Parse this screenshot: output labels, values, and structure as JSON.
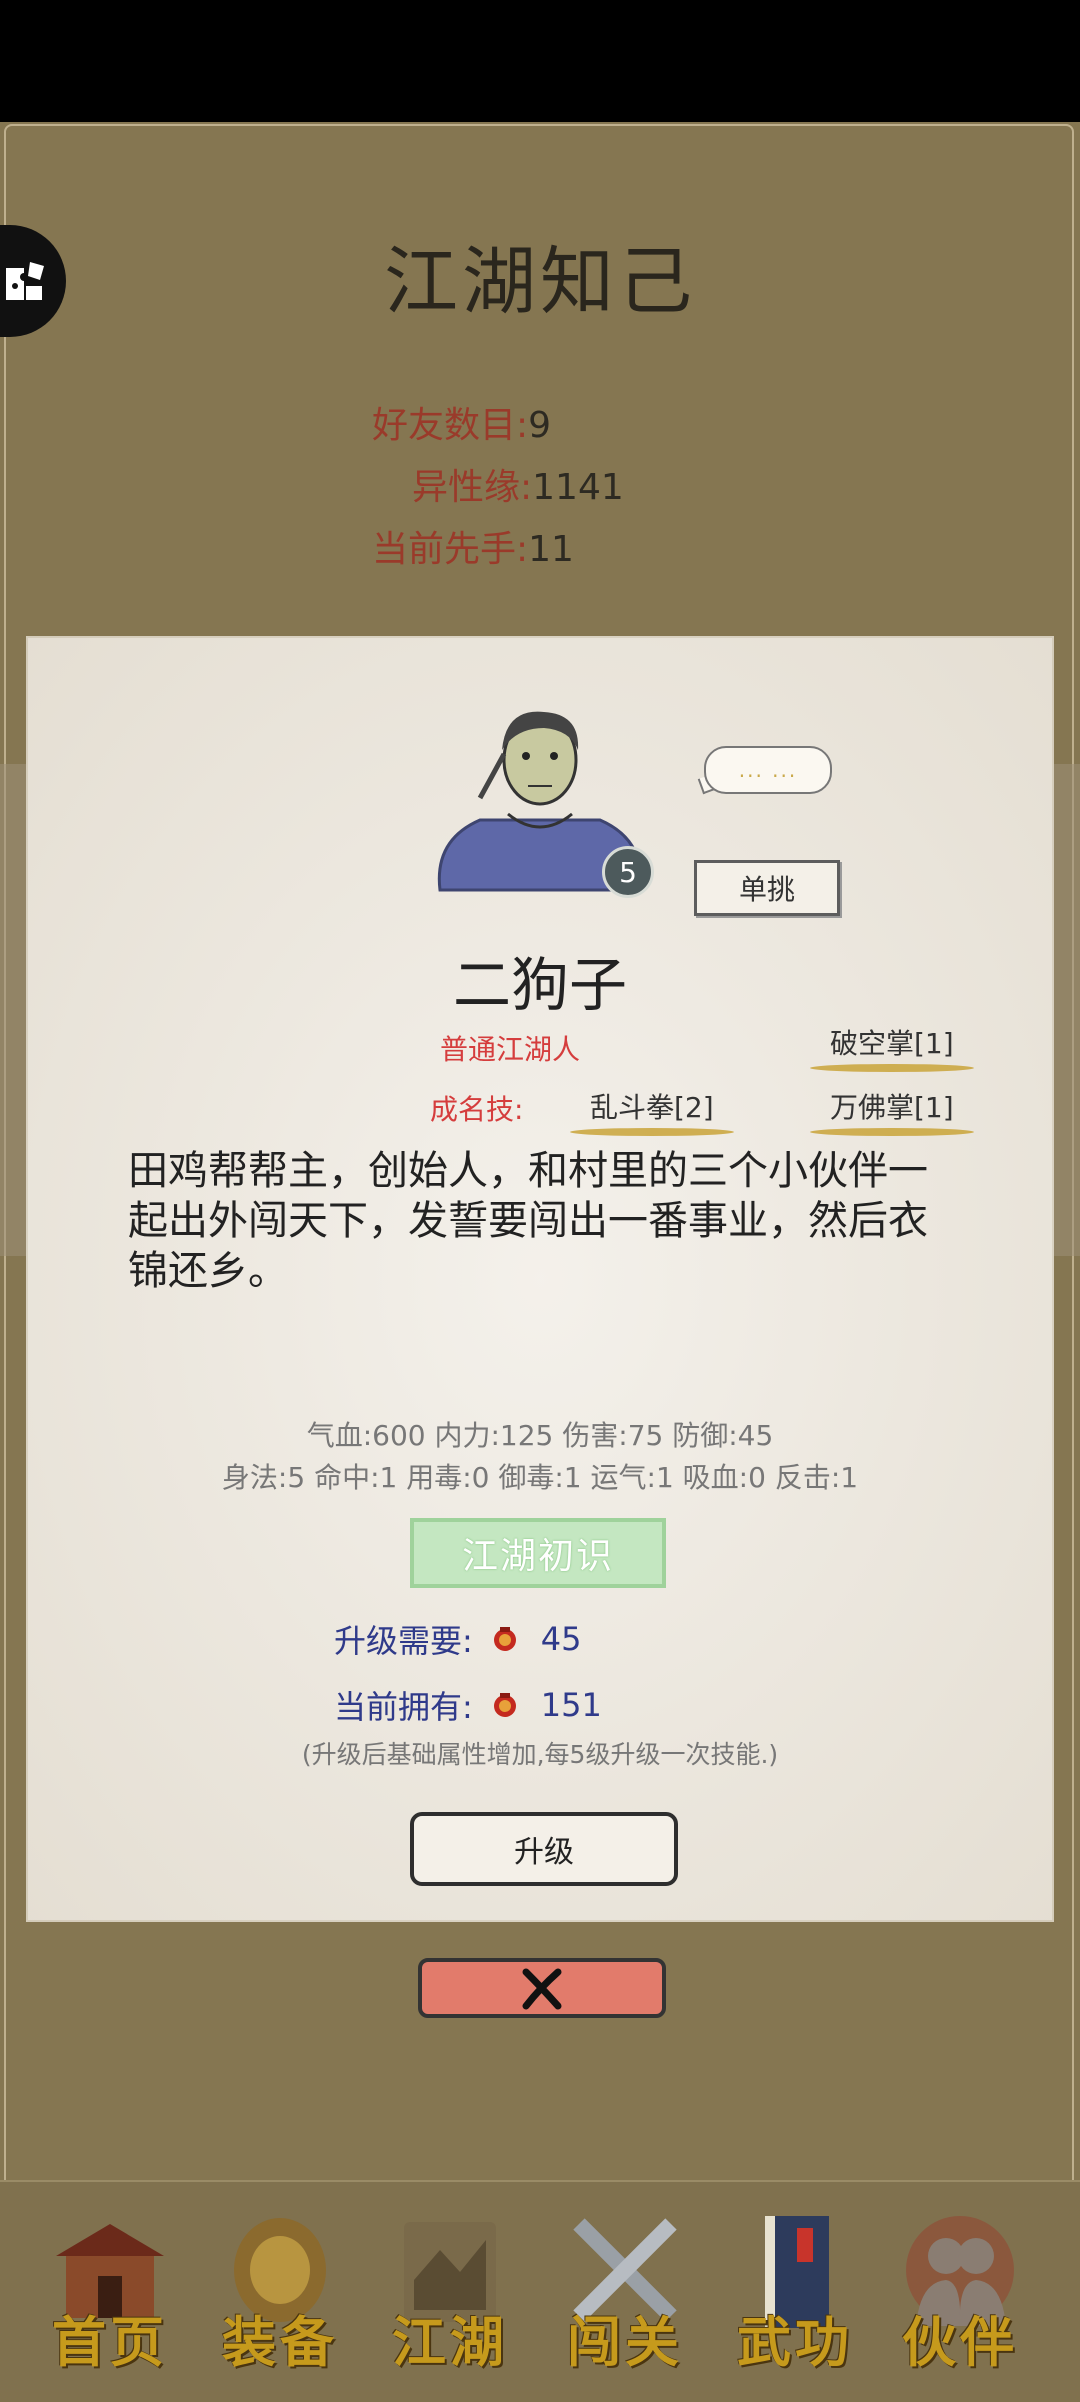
{
  "header": {
    "title": "江湖知己"
  },
  "summary": [
    {
      "label": "好友数目:",
      "value": "9"
    },
    {
      "label": "异性缘:",
      "value": "1141"
    },
    {
      "label": "当前先手:",
      "value": "11"
    }
  ],
  "character": {
    "level": "5",
    "bubble": "... ...",
    "duel_label": "单挑",
    "name": "二狗子",
    "rank": "普通江湖人",
    "skill_label": "成名技:",
    "skills": [
      "破空掌[1]",
      "乱斗拳[2]",
      "万佛掌[1]"
    ],
    "description": "田鸡帮帮主，创始人，和村里的三个小伙伴一起出外闯天下，发誓要闯出一番事业，然后衣锦还乡。",
    "attrs_line1": "气血:600  内力:125  伤害:75  防御:45",
    "attrs_line2": "身法:5  命中:1  用毒:0  御毒:1  运气:1  吸血:0  反击:1",
    "realm": "江湖初识",
    "upgrade_need_label": "升级需要:",
    "upgrade_need_value": "45",
    "owned_label": "当前拥有:",
    "owned_value": "151",
    "note": "(升级后基础属性增加,每5级升级一次技能.)",
    "upgrade_button": "升级"
  },
  "nav": [
    {
      "label": "首页",
      "icon": "house-icon"
    },
    {
      "label": "装备",
      "icon": "armor-icon"
    },
    {
      "label": "江湖",
      "icon": "scroll-icon"
    },
    {
      "label": "闯关",
      "icon": "swords-icon"
    },
    {
      "label": "武功",
      "icon": "book-icon"
    },
    {
      "label": "伙伴",
      "icon": "companions-icon"
    }
  ],
  "colors": {
    "background": "#857651",
    "card": "#eee9e0",
    "accent_red": "#d53d3d",
    "gold": "#c69a1c",
    "close": "#e27b6b"
  }
}
